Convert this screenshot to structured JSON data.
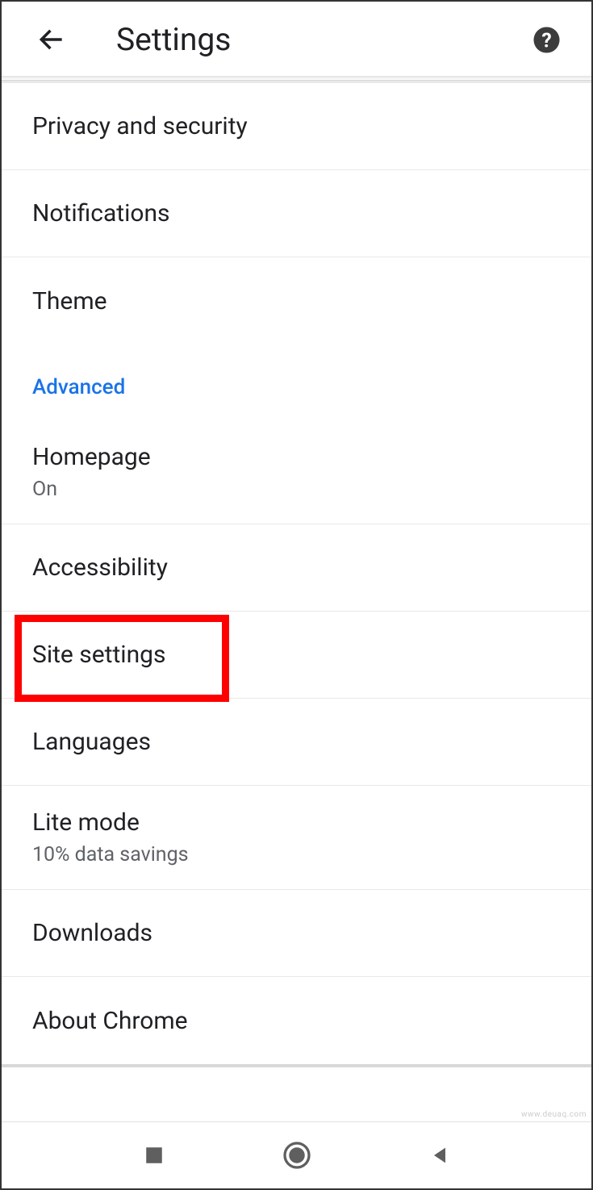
{
  "header": {
    "title": "Settings"
  },
  "section_header": "Advanced",
  "items": [
    {
      "label": "Privacy and security",
      "sublabel": null
    },
    {
      "label": "Notifications",
      "sublabel": null
    },
    {
      "label": "Theme",
      "sublabel": null
    },
    {
      "label": "Homepage",
      "sublabel": "On"
    },
    {
      "label": "Accessibility",
      "sublabel": null
    },
    {
      "label": "Site settings",
      "sublabel": null
    },
    {
      "label": "Languages",
      "sublabel": null
    },
    {
      "label": "Lite mode",
      "sublabel": "10% data savings"
    },
    {
      "label": "Downloads",
      "sublabel": null
    },
    {
      "label": "About Chrome",
      "sublabel": null
    }
  ],
  "highlighted_index": 5,
  "watermark": "www.deuaq.com"
}
